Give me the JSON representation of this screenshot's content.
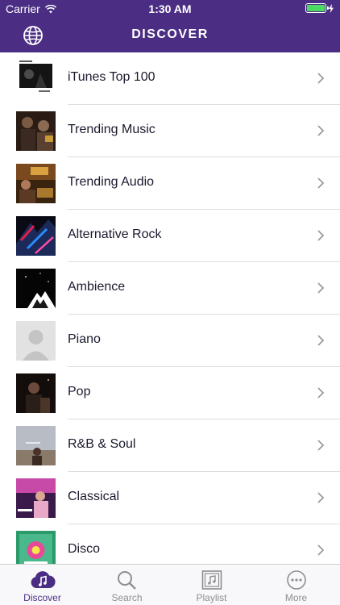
{
  "status_bar": {
    "carrier": "Carrier",
    "time": "1:30 AM",
    "battery_level": 1.0,
    "battery_color": "#4cd964"
  },
  "nav": {
    "title": "DISCOVER",
    "left_icon": "globe-icon"
  },
  "colors": {
    "accent": "#4b2e83",
    "text": "#1a1a2e",
    "chevron": "#9b9b9b"
  },
  "genres": [
    {
      "label": "iTunes Top 100",
      "thumb": "itunes-top-100-cover"
    },
    {
      "label": "Trending Music",
      "thumb": "trending-music-cover"
    },
    {
      "label": "Trending Audio",
      "thumb": "trending-audio-cover"
    },
    {
      "label": "Alternative Rock",
      "thumb": "alternative-rock-cover"
    },
    {
      "label": "Ambience",
      "thumb": "ambience-cover"
    },
    {
      "label": "Piano",
      "thumb": "placeholder-avatar"
    },
    {
      "label": "Pop",
      "thumb": "pop-cover"
    },
    {
      "label": "R&B & Soul",
      "thumb": "rnb-soul-cover"
    },
    {
      "label": "Classical",
      "thumb": "classical-cover"
    },
    {
      "label": "Disco",
      "thumb": "disco-cover"
    }
  ],
  "tabs": [
    {
      "label": "Discover",
      "icon": "music-cloud-icon",
      "active": true
    },
    {
      "label": "Search",
      "icon": "search-icon",
      "active": false
    },
    {
      "label": "Playlist",
      "icon": "playlist-icon",
      "active": false
    },
    {
      "label": "More",
      "icon": "more-icon",
      "active": false
    }
  ]
}
